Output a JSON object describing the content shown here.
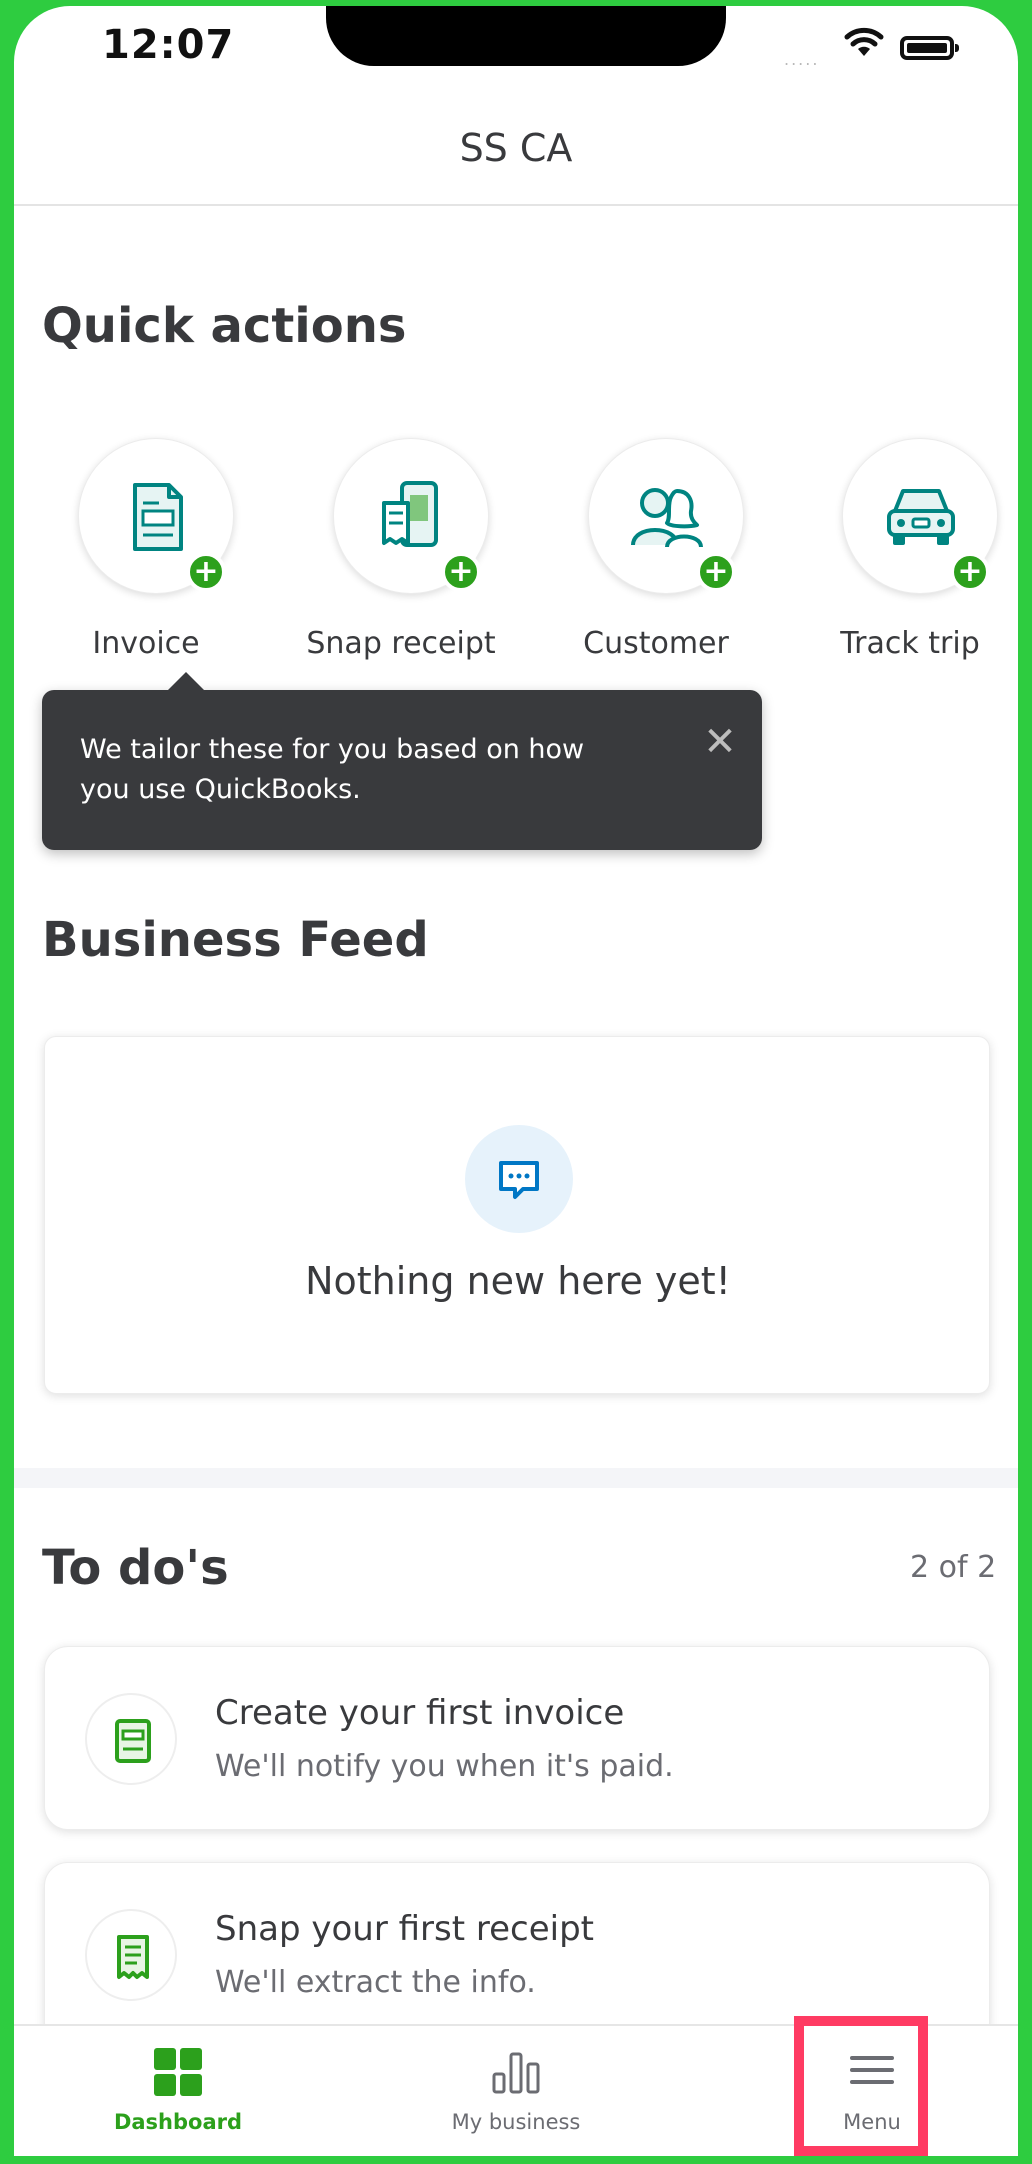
{
  "status_bar": {
    "time": "12:07",
    "signal": "....."
  },
  "header": {
    "title": "SS CA"
  },
  "quick_actions": {
    "title": "Quick actions",
    "items": [
      {
        "label": "Invoice",
        "icon": "invoice-icon"
      },
      {
        "label": "Snap receipt",
        "icon": "snap-receipt-icon"
      },
      {
        "label": "Customer",
        "icon": "customer-icon"
      },
      {
        "label": "Track trip",
        "icon": "car-icon"
      }
    ],
    "plus_glyph": "+"
  },
  "tooltip": {
    "text": "We tailor these for you based on how you use QuickBooks.",
    "close_glyph": "✕"
  },
  "business_feed": {
    "title": "Business Feed",
    "empty_text": "Nothing new here yet!",
    "icon": "chat-bubble-icon"
  },
  "todos": {
    "title": "To do's",
    "count": "2 of 2",
    "items": [
      {
        "title": "Create your first invoice",
        "subtitle": "We'll notify you when it's paid.",
        "icon": "invoice-icon"
      },
      {
        "title": "Snap your first receipt",
        "subtitle": "We'll extract the info.",
        "icon": "receipt-icon"
      }
    ]
  },
  "bottom_nav": {
    "items": [
      {
        "label": "Dashboard",
        "icon": "dashboard-icon",
        "active": true
      },
      {
        "label": "My business",
        "icon": "bar-chart-icon",
        "active": false
      },
      {
        "label": "Menu",
        "icon": "hamburger-icon",
        "active": false
      }
    ]
  },
  "colors": {
    "brand_green": "#2ca01c",
    "icon_teal": "#008481",
    "tooltip_bg": "#393a3d",
    "highlight": "#ff3b63",
    "frame_border": "#2ecc40"
  }
}
